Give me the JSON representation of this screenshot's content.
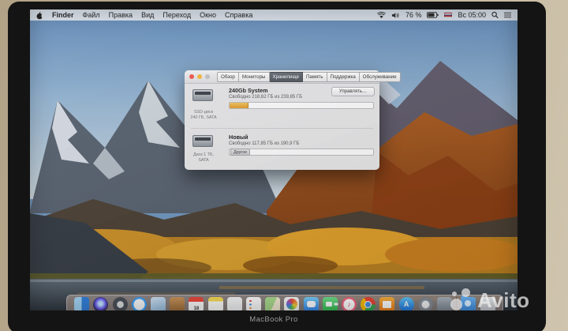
{
  "photo": {
    "brand_label": "MacBook Pro"
  },
  "watermark": {
    "text": "Avito"
  },
  "menu_bar": {
    "items": [
      "Finder",
      "Файл",
      "Правка",
      "Вид",
      "Переход",
      "Окно",
      "Справка"
    ],
    "status": {
      "battery_pct": "76 %",
      "clock": "Вс 05:00"
    }
  },
  "about_window": {
    "tabs": [
      {
        "label": "Обзор",
        "active": false
      },
      {
        "label": "Мониторы",
        "active": false
      },
      {
        "label": "Хранилище",
        "active": true
      },
      {
        "label": "Память",
        "active": false
      },
      {
        "label": "Поддержка",
        "active": false
      },
      {
        "label": "Обслуживание",
        "active": false
      }
    ],
    "disks": [
      {
        "name": "240Gb System",
        "free_text": "Свободно 218,62 ГБ из 239,85 ГБ",
        "device_line1": "SSD-диск",
        "device_line2": "240 ГБ, SATA",
        "manage_label": "Управлять…",
        "used_color": "#e9a63e"
      },
      {
        "name": "Новый",
        "free_text": "Свободно 117,85 ГБ из 190,9 ГБ",
        "device_line1": "Диск 1 ТБ,",
        "device_line2": "SATA",
        "other_chip_label": "Другое"
      }
    ]
  },
  "dock": {
    "calendar_day": "18",
    "items": [
      "finder",
      "siri",
      "launchpad",
      "safari",
      "preview",
      "contacts",
      "calendar",
      "notes",
      "textedit",
      "reminders",
      "maps",
      "photos",
      "messages",
      "facetime",
      "itunes",
      "chrome",
      "ibooks",
      "app-store",
      "system-preferences",
      "network",
      "downloads-folder",
      "trash"
    ]
  }
}
